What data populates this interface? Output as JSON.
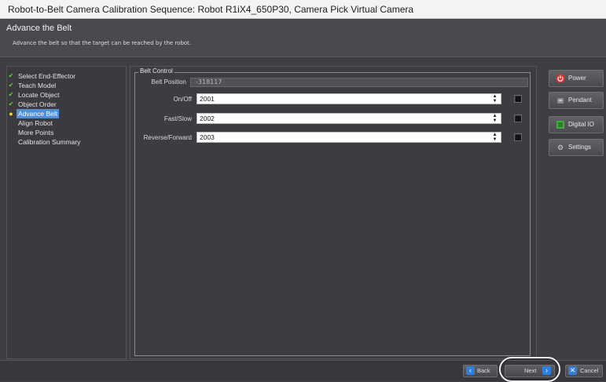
{
  "window": {
    "title": "Robot-to-Belt Camera Calibration Sequence: Robot R1iX4_650P30, Camera Pick Virtual Camera"
  },
  "header": {
    "title": "Advance the Belt",
    "description": "Advance the belt so that the target can be reached by the robot."
  },
  "steps": [
    {
      "label": "Select End-Effector",
      "state": "done"
    },
    {
      "label": "Teach Model",
      "state": "done"
    },
    {
      "label": "Locate Object",
      "state": "done"
    },
    {
      "label": "Object Order",
      "state": "done"
    },
    {
      "label": "Advance Belt",
      "state": "current"
    },
    {
      "label": "Align Robot",
      "state": "pending"
    },
    {
      "label": "More Points",
      "state": "pending"
    },
    {
      "label": "Calibration Summary",
      "state": "pending"
    }
  ],
  "belt_control": {
    "group_label": "Belt Control",
    "belt_position_label": "Belt Position",
    "belt_position_value": "-318117",
    "fields": [
      {
        "label": "On/Off",
        "value": "2001"
      },
      {
        "label": "Fast/Slow",
        "value": "2002"
      },
      {
        "label": "Reverse/Forward",
        "value": "2003"
      }
    ]
  },
  "side_buttons": [
    {
      "label": "Power",
      "icon": "power-icon"
    },
    {
      "label": "Pendant",
      "icon": "pendant-icon"
    },
    {
      "label": "Digital IO",
      "icon": "digital-io-icon"
    },
    {
      "label": "Settings",
      "icon": "settings-icon"
    }
  ],
  "footer": {
    "back_label": "Back",
    "next_label": "Next",
    "cancel_label": "Cancel"
  },
  "colors": {
    "step_done_check": "#69d24a",
    "step_current_bullet": "#f2d14b",
    "step_selected_bg": "#4f8fd6",
    "power_icon": "#d9382e",
    "digital_io_icon": "#3fae3c",
    "nav_icon": "#2f7fd9"
  }
}
